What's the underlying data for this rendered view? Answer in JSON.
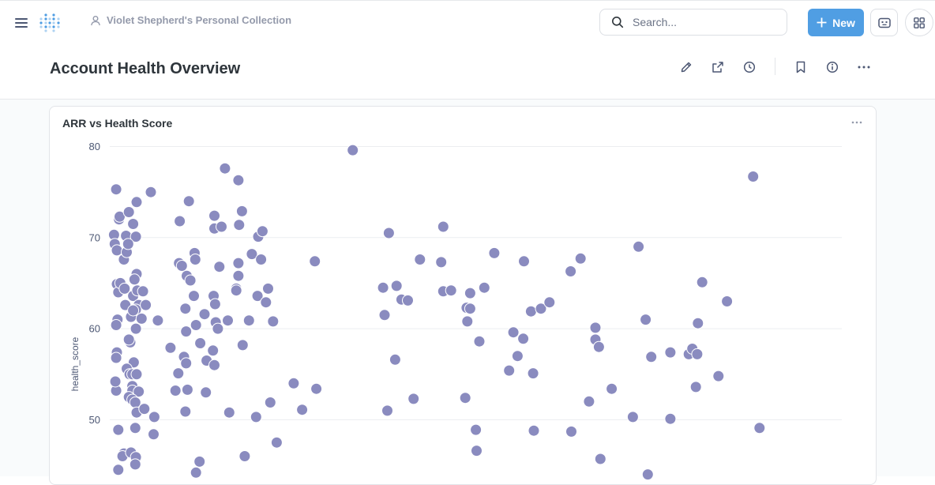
{
  "topbar": {
    "breadcrumb": "Violet Shepherd's Personal Collection",
    "search_placeholder": "Search...",
    "new_label": "New"
  },
  "colors": {
    "accent": "#509ee3",
    "point": "#8a8bbf"
  },
  "page": {
    "title": "Account Health Overview"
  },
  "card": {
    "title": "ARR vs Health Score"
  },
  "chart_data": {
    "type": "scatter",
    "title": "ARR vs Health Score",
    "xlabel": "",
    "ylabel": "health_score",
    "yticks": [
      50,
      60,
      70,
      80
    ],
    "xlim": [
      0,
      1
    ],
    "ylim": [
      43.5,
      81
    ],
    "grid": true,
    "note": "x axis scale not visible in screenshot; x values are relative positions 0-1",
    "points": [
      [
        0.0087,
        75.3
      ],
      [
        0.0058,
        70.3
      ],
      [
        0.0126,
        72.0
      ],
      [
        0.0135,
        72.3
      ],
      [
        0.0261,
        72.8
      ],
      [
        0.0222,
        70.2
      ],
      [
        0.0193,
        67.6
      ],
      [
        0.0068,
        69.3
      ],
      [
        0.0097,
        68.6
      ],
      [
        0.0319,
        71.5
      ],
      [
        0.0367,
        73.9
      ],
      [
        0.0357,
        70.1
      ],
      [
        0.0561,
        75.0
      ],
      [
        0.0232,
        68.4
      ],
      [
        0.0251,
        69.3
      ],
      [
        0.0097,
        64.9
      ],
      [
        0.0116,
        64.0
      ],
      [
        0.0145,
        65.0
      ],
      [
        0.0203,
        64.4
      ],
      [
        0.0367,
        66.0
      ],
      [
        0.0338,
        65.4
      ],
      [
        0.0319,
        63.6
      ],
      [
        0.0377,
        64.2
      ],
      [
        0.0454,
        64.1
      ],
      [
        0.0212,
        62.6
      ],
      [
        0.0396,
        62.6
      ],
      [
        0.029,
        61.3
      ],
      [
        0.0357,
        62.1
      ],
      [
        0.0319,
        62.0
      ],
      [
        0.0492,
        62.6
      ],
      [
        0.0435,
        61.1
      ],
      [
        0.0106,
        61.0
      ],
      [
        0.0087,
        60.4
      ],
      [
        0.0357,
        60.0
      ],
      [
        0.0657,
        60.9
      ],
      [
        0.028,
        58.5
      ],
      [
        0.0261,
        58.8
      ],
      [
        0.0097,
        57.4
      ],
      [
        0.0087,
        56.8
      ],
      [
        0.0328,
        56.3
      ],
      [
        0.0232,
        55.6
      ],
      [
        0.0271,
        55.0
      ],
      [
        0.0309,
        55.0
      ],
      [
        0.0367,
        55.0
      ],
      [
        0.0309,
        53.7
      ],
      [
        0.0309,
        53.2
      ],
      [
        0.0261,
        52.5
      ],
      [
        0.0087,
        53.2
      ],
      [
        0.0077,
        54.2
      ],
      [
        0.0396,
        53.1
      ],
      [
        0.0309,
        52.2
      ],
      [
        0.0348,
        51.9
      ],
      [
        0.0367,
        50.8
      ],
      [
        0.0473,
        51.2
      ],
      [
        0.0608,
        50.3
      ],
      [
        0.0348,
        49.1
      ],
      [
        0.0116,
        48.9
      ],
      [
        0.0599,
        48.4
      ],
      [
        0.0193,
        46.3
      ],
      [
        0.0174,
        46.0
      ],
      [
        0.029,
        46.4
      ],
      [
        0.0357,
        45.9
      ],
      [
        0.0348,
        45.1
      ],
      [
        0.0116,
        44.5
      ],
      [
        0.0956,
        71.8
      ],
      [
        0.1081,
        74.0
      ],
      [
        0.0946,
        67.2
      ],
      [
        0.0985,
        66.9
      ],
      [
        0.1052,
        65.8
      ],
      [
        0.1101,
        65.3
      ],
      [
        0.1159,
        68.3
      ],
      [
        0.1168,
        67.6
      ],
      [
        0.1033,
        62.2
      ],
      [
        0.1149,
        63.6
      ],
      [
        0.1178,
        60.4
      ],
      [
        0.1043,
        59.7
      ],
      [
        0.1236,
        58.4
      ],
      [
        0.1294,
        61.6
      ],
      [
        0.1014,
        56.9
      ],
      [
        0.1043,
        56.2
      ],
      [
        0.083,
        57.9
      ],
      [
        0.0936,
        55.1
      ],
      [
        0.0898,
        53.2
      ],
      [
        0.1062,
        53.3
      ],
      [
        0.1323,
        56.5
      ],
      [
        0.1313,
        53.0
      ],
      [
        0.1033,
        50.9
      ],
      [
        0.1226,
        45.4
      ],
      [
        0.1178,
        44.2
      ],
      [
        0.1429,
        72.4
      ],
      [
        0.1429,
        71.0
      ],
      [
        0.1526,
        71.2
      ],
      [
        0.1574,
        77.6
      ],
      [
        0.1757,
        76.3
      ],
      [
        0.1806,
        72.9
      ],
      [
        0.1767,
        71.4
      ],
      [
        0.1497,
        66.8
      ],
      [
        0.1757,
        67.2
      ],
      [
        0.1757,
        65.8
      ],
      [
        0.1728,
        64.4
      ],
      [
        0.1728,
        64.2
      ],
      [
        0.1419,
        63.6
      ],
      [
        0.1439,
        62.7
      ],
      [
        0.1448,
        60.7
      ],
      [
        0.1477,
        60.0
      ],
      [
        0.1613,
        60.9
      ],
      [
        0.1816,
        58.2
      ],
      [
        0.141,
        57.6
      ],
      [
        0.1429,
        56.0
      ],
      [
        0.1632,
        50.8
      ],
      [
        0.1844,
        46.0
      ],
      [
        0.1941,
        68.2
      ],
      [
        0.2028,
        70.1
      ],
      [
        0.2086,
        70.7
      ],
      [
        0.2067,
        67.6
      ],
      [
        0.2018,
        63.6
      ],
      [
        0.2163,
        64.4
      ],
      [
        0.2134,
        62.9
      ],
      [
        0.1902,
        60.9
      ],
      [
        0.2231,
        60.8
      ],
      [
        0.1999,
        50.3
      ],
      [
        0.2193,
        51.9
      ],
      [
        0.228,
        47.5
      ],
      [
        0.2512,
        54.0
      ],
      [
        0.2628,
        51.1
      ],
      [
        0.2822,
        53.4
      ],
      [
        0.2802,
        67.4
      ],
      [
        0.3319,
        79.6
      ],
      [
        0.3812,
        70.5
      ],
      [
        0.3734,
        64.5
      ],
      [
        0.3918,
        64.7
      ],
      [
        0.3985,
        63.2
      ],
      [
        0.3754,
        61.5
      ],
      [
        0.4072,
        63.1
      ],
      [
        0.3899,
        56.6
      ],
      [
        0.3792,
        51.0
      ],
      [
        0.415,
        52.3
      ],
      [
        0.4237,
        67.6
      ],
      [
        0.4527,
        67.3
      ],
      [
        0.4556,
        71.2
      ],
      [
        0.4556,
        64.1
      ],
      [
        0.4662,
        64.2
      ],
      [
        0.4875,
        62.3
      ],
      [
        0.4923,
        62.2
      ],
      [
        0.4923,
        63.9
      ],
      [
        0.4885,
        60.8
      ],
      [
        0.5049,
        58.6
      ],
      [
        0.4856,
        52.4
      ],
      [
        0.5001,
        48.9
      ],
      [
        0.5011,
        46.6
      ],
      [
        0.5117,
        64.5
      ],
      [
        0.5252,
        68.3
      ],
      [
        0.5455,
        55.4
      ],
      [
        0.5513,
        59.6
      ],
      [
        0.5571,
        57.0
      ],
      [
        0.5648,
        58.9
      ],
      [
        0.5658,
        67.4
      ],
      [
        0.5754,
        61.9
      ],
      [
        0.589,
        62.2
      ],
      [
        0.5783,
        55.1
      ],
      [
        0.5793,
        48.8
      ],
      [
        0.6006,
        62.9
      ],
      [
        0.6296,
        66.3
      ],
      [
        0.6431,
        67.7
      ],
      [
        0.6305,
        48.7
      ],
      [
        0.6547,
        52.0
      ],
      [
        0.6634,
        60.1
      ],
      [
        0.6634,
        58.8
      ],
      [
        0.6682,
        58.0
      ],
      [
        0.6702,
        45.7
      ],
      [
        0.6856,
        53.4
      ],
      [
        0.7146,
        50.3
      ],
      [
        0.7223,
        69.0
      ],
      [
        0.732,
        61.0
      ],
      [
        0.7397,
        56.9
      ],
      [
        0.7349,
        44.0
      ],
      [
        0.7658,
        57.4
      ],
      [
        0.7658,
        50.1
      ],
      [
        0.7909,
        57.2
      ],
      [
        0.7958,
        57.8
      ],
      [
        0.8025,
        57.2
      ],
      [
        0.8035,
        60.6
      ],
      [
        0.8093,
        65.1
      ],
      [
        0.8006,
        53.6
      ],
      [
        0.8315,
        54.8
      ],
      [
        0.8432,
        63.0
      ],
      [
        0.8789,
        76.7
      ],
      [
        0.8876,
        49.1
      ]
    ]
  }
}
